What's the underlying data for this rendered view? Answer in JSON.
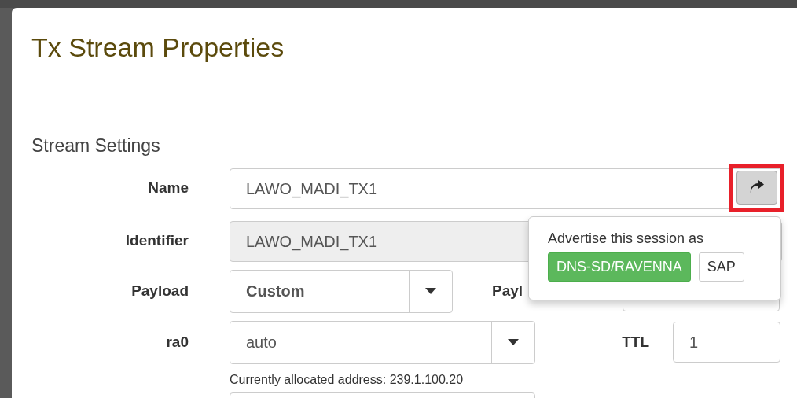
{
  "modal": {
    "title": "Tx Stream Properties"
  },
  "section_title": "Stream Settings",
  "name": {
    "label": "Name",
    "value": "LAWO_MADI_TX1"
  },
  "share_button": {
    "highlighted": true
  },
  "advertise_popover": {
    "text": "Advertise this session as",
    "options": [
      {
        "label": "DNS-SD/RAVENNA",
        "selected": true
      },
      {
        "label": "SAP",
        "selected": false
      }
    ]
  },
  "identifier": {
    "label": "Identifier",
    "value": "LAWO_MADI_TX1",
    "readonly": true
  },
  "payload": {
    "label": "Payload",
    "value": "Custom"
  },
  "payload_id": {
    "label": "Payl"
  },
  "interface": {
    "label": "ra0",
    "value": "auto",
    "help": "Currently allocated address: 239.1.100.20"
  },
  "ttl": {
    "label": "TTL",
    "value": "1"
  }
}
